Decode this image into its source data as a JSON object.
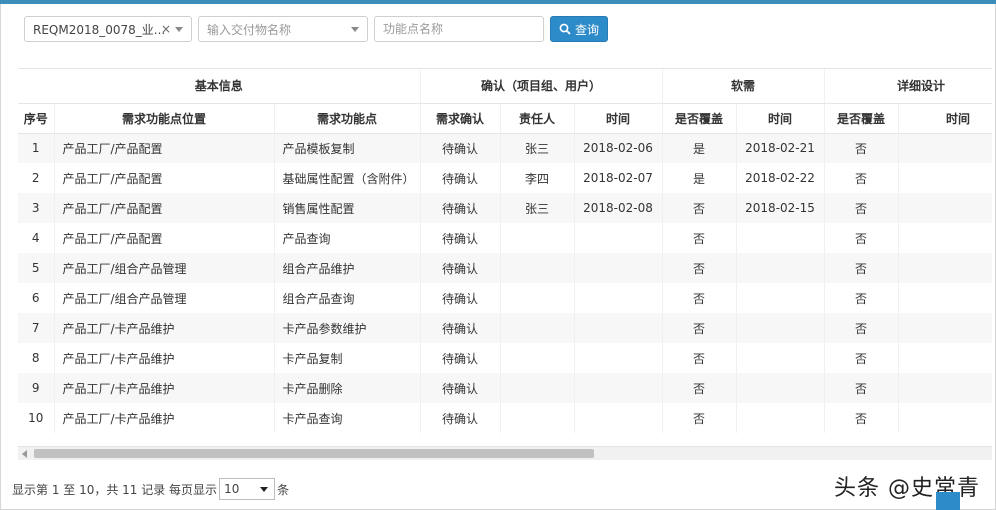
{
  "filters": {
    "requirement_select": "REQM2018_0078_业...",
    "clear_symbol": "×",
    "deliverable_placeholder": "输入交付物名称",
    "function_placeholder": "功能点名称",
    "query_label": "查询"
  },
  "table": {
    "group_headers": [
      "基本信息",
      "确认（项目组、用户）",
      "软需",
      "详细设计"
    ],
    "columns": [
      "序号",
      "需求功能点位置",
      "需求功能点",
      "需求确认",
      "责任人",
      "时间",
      "是否覆盖",
      "时间",
      "是否覆盖",
      "时间"
    ],
    "rows": [
      [
        "1",
        "产品工厂/产品配置",
        "产品模板复制",
        "待确认",
        "张三",
        "2018-02-06",
        "是",
        "2018-02-21",
        "否",
        ""
      ],
      [
        "2",
        "产品工厂/产品配置",
        "基础属性配置（含附件）",
        "待确认",
        "李四",
        "2018-02-07",
        "是",
        "2018-02-22",
        "否",
        ""
      ],
      [
        "3",
        "产品工厂/产品配置",
        "销售属性配置",
        "待确认",
        "张三",
        "2018-02-08",
        "否",
        "2018-02-15",
        "否",
        ""
      ],
      [
        "4",
        "产品工厂/产品配置",
        "产品查询",
        "待确认",
        "",
        "",
        "否",
        "",
        "否",
        ""
      ],
      [
        "5",
        "产品工厂/组合产品管理",
        "组合产品维护",
        "待确认",
        "",
        "",
        "否",
        "",
        "否",
        ""
      ],
      [
        "6",
        "产品工厂/组合产品管理",
        "组合产品查询",
        "待确认",
        "",
        "",
        "否",
        "",
        "否",
        ""
      ],
      [
        "7",
        "产品工厂/卡产品维护",
        "卡产品参数维护",
        "待确认",
        "",
        "",
        "否",
        "",
        "否",
        ""
      ],
      [
        "8",
        "产品工厂/卡产品维护",
        "卡产品复制",
        "待确认",
        "",
        "",
        "否",
        "",
        "否",
        ""
      ],
      [
        "9",
        "产品工厂/卡产品维护",
        "卡产品删除",
        "待确认",
        "",
        "",
        "否",
        "",
        "否",
        ""
      ],
      [
        "10",
        "产品工厂/卡产品维护",
        "卡产品查询",
        "待确认",
        "",
        "",
        "否",
        "",
        "否",
        ""
      ]
    ]
  },
  "pager": {
    "summary": "显示第 1 至 10，共 11 记录 每页显示",
    "page_size": "10",
    "suffix": "条"
  },
  "watermark": "头条 @史常青",
  "colors": {
    "accent": "#2e8bc9",
    "topline": "#3c8dbc"
  }
}
